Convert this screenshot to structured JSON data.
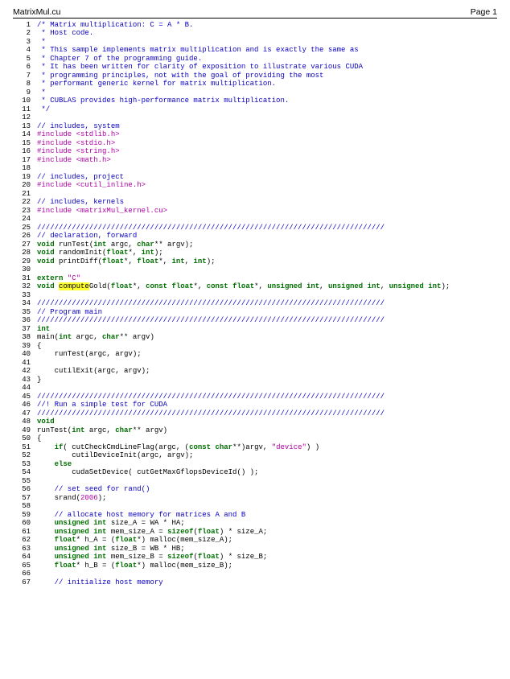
{
  "header": {
    "filename": "MatrixMul.cu",
    "page_label": "Page 1"
  },
  "code_lines": [
    {
      "n": 1,
      "tokens": [
        {
          "t": "/* Matrix multiplication: C = A * B.",
          "c": "c-comment"
        }
      ]
    },
    {
      "n": 2,
      "tokens": [
        {
          "t": " * Host code.",
          "c": "c-comment"
        }
      ]
    },
    {
      "n": 3,
      "tokens": [
        {
          "t": " *",
          "c": "c-comment"
        }
      ]
    },
    {
      "n": 4,
      "tokens": [
        {
          "t": " * This sample implements matrix multiplication and is exactly the same as",
          "c": "c-comment"
        }
      ]
    },
    {
      "n": 5,
      "tokens": [
        {
          "t": " * Chapter 7 of the programming guide.",
          "c": "c-comment"
        }
      ]
    },
    {
      "n": 6,
      "tokens": [
        {
          "t": " * It has been written for clarity of exposition to illustrate various CUDA",
          "c": "c-comment"
        }
      ]
    },
    {
      "n": 7,
      "tokens": [
        {
          "t": " * programming principles, not with the goal of providing the most",
          "c": "c-comment"
        }
      ]
    },
    {
      "n": 8,
      "tokens": [
        {
          "t": " * performant generic kernel for matrix multiplication.",
          "c": "c-comment"
        }
      ]
    },
    {
      "n": 9,
      "tokens": [
        {
          "t": " *",
          "c": "c-comment"
        }
      ]
    },
    {
      "n": 10,
      "tokens": [
        {
          "t": " * CUBLAS provides high-performance matrix multiplication.",
          "c": "c-comment"
        }
      ]
    },
    {
      "n": 11,
      "tokens": [
        {
          "t": " */",
          "c": "c-comment"
        }
      ]
    },
    {
      "n": 12,
      "tokens": []
    },
    {
      "n": 13,
      "tokens": [
        {
          "t": "// includes, system",
          "c": "c-comment"
        }
      ]
    },
    {
      "n": 14,
      "tokens": [
        {
          "t": "#include ",
          "c": "c-pp"
        },
        {
          "t": "<stdlib.h>",
          "c": "c-str"
        }
      ]
    },
    {
      "n": 15,
      "tokens": [
        {
          "t": "#include ",
          "c": "c-pp"
        },
        {
          "t": "<stdio.h>",
          "c": "c-str"
        }
      ]
    },
    {
      "n": 16,
      "tokens": [
        {
          "t": "#include ",
          "c": "c-pp"
        },
        {
          "t": "<string.h>",
          "c": "c-str"
        }
      ]
    },
    {
      "n": 17,
      "tokens": [
        {
          "t": "#include ",
          "c": "c-pp"
        },
        {
          "t": "<math.h>",
          "c": "c-str"
        }
      ]
    },
    {
      "n": 18,
      "tokens": []
    },
    {
      "n": 19,
      "tokens": [
        {
          "t": "// includes, project",
          "c": "c-comment"
        }
      ]
    },
    {
      "n": 20,
      "tokens": [
        {
          "t": "#include ",
          "c": "c-pp"
        },
        {
          "t": "<cutil_inline.h>",
          "c": "c-str"
        }
      ]
    },
    {
      "n": 21,
      "tokens": []
    },
    {
      "n": 22,
      "tokens": [
        {
          "t": "// includes, kernels",
          "c": "c-comment"
        }
      ]
    },
    {
      "n": 23,
      "tokens": [
        {
          "t": "#include ",
          "c": "c-pp"
        },
        {
          "t": "<matrixMul_kernel.cu>",
          "c": "c-str"
        }
      ]
    },
    {
      "n": 24,
      "tokens": []
    },
    {
      "n": 25,
      "tokens": [
        {
          "t": "////////////////////////////////////////////////////////////////////////////////",
          "c": "c-comment"
        }
      ]
    },
    {
      "n": 26,
      "tokens": [
        {
          "t": "// declaration, forward",
          "c": "c-comment"
        }
      ]
    },
    {
      "n": 27,
      "tokens": [
        {
          "t": "void",
          "c": "c-kw"
        },
        {
          "t": " runTest("
        },
        {
          "t": "int",
          "c": "c-kw"
        },
        {
          "t": " argc, "
        },
        {
          "t": "char",
          "c": "c-kw"
        },
        {
          "t": "** argv);"
        }
      ]
    },
    {
      "n": 28,
      "tokens": [
        {
          "t": "void",
          "c": "c-kw"
        },
        {
          "t": " randomInit("
        },
        {
          "t": "float",
          "c": "c-kw"
        },
        {
          "t": "*, "
        },
        {
          "t": "int",
          "c": "c-kw"
        },
        {
          "t": ");"
        }
      ]
    },
    {
      "n": 29,
      "tokens": [
        {
          "t": "void",
          "c": "c-kw"
        },
        {
          "t": " printDiff("
        },
        {
          "t": "float",
          "c": "c-kw"
        },
        {
          "t": "*, "
        },
        {
          "t": "float",
          "c": "c-kw"
        },
        {
          "t": "*, "
        },
        {
          "t": "int",
          "c": "c-kw"
        },
        {
          "t": ", "
        },
        {
          "t": "int",
          "c": "c-kw"
        },
        {
          "t": ");"
        }
      ]
    },
    {
      "n": 30,
      "tokens": []
    },
    {
      "n": 31,
      "tokens": [
        {
          "t": "extern",
          "c": "c-kw"
        },
        {
          "t": " "
        },
        {
          "t": "\"C\"",
          "c": "c-str"
        }
      ]
    },
    {
      "n": 32,
      "tokens": [
        {
          "t": "void",
          "c": "c-kw"
        },
        {
          "t": " "
        },
        {
          "t": "compute",
          "c": "c-hl"
        },
        {
          "t": "Gold("
        },
        {
          "t": "float",
          "c": "c-kw"
        },
        {
          "t": "*, "
        },
        {
          "t": "const",
          "c": "c-kw"
        },
        {
          "t": " "
        },
        {
          "t": "float",
          "c": "c-kw"
        },
        {
          "t": "*, "
        },
        {
          "t": "const",
          "c": "c-kw"
        },
        {
          "t": " "
        },
        {
          "t": "float",
          "c": "c-kw"
        },
        {
          "t": "*, "
        },
        {
          "t": "unsigned",
          "c": "c-kw"
        },
        {
          "t": " "
        },
        {
          "t": "int",
          "c": "c-kw"
        },
        {
          "t": ", "
        },
        {
          "t": "unsigned",
          "c": "c-kw"
        },
        {
          "t": " "
        },
        {
          "t": "int",
          "c": "c-kw"
        },
        {
          "t": ", "
        },
        {
          "t": "unsigned",
          "c": "c-kw"
        },
        {
          "t": " "
        },
        {
          "t": "int",
          "c": "c-kw"
        },
        {
          "t": ");"
        }
      ]
    },
    {
      "n": 33,
      "tokens": []
    },
    {
      "n": 34,
      "tokens": [
        {
          "t": "////////////////////////////////////////////////////////////////////////////////",
          "c": "c-comment"
        }
      ]
    },
    {
      "n": 35,
      "tokens": [
        {
          "t": "// Program main",
          "c": "c-comment"
        }
      ]
    },
    {
      "n": 36,
      "tokens": [
        {
          "t": "////////////////////////////////////////////////////////////////////////////////",
          "c": "c-comment"
        }
      ]
    },
    {
      "n": 37,
      "tokens": [
        {
          "t": "int",
          "c": "c-kw"
        }
      ]
    },
    {
      "n": 38,
      "tokens": [
        {
          "t": "main("
        },
        {
          "t": "int",
          "c": "c-kw"
        },
        {
          "t": " argc, "
        },
        {
          "t": "char",
          "c": "c-kw"
        },
        {
          "t": "** argv)"
        }
      ]
    },
    {
      "n": 39,
      "tokens": [
        {
          "t": "{"
        }
      ]
    },
    {
      "n": 40,
      "tokens": [
        {
          "t": "    runTest(argc, argv);"
        }
      ]
    },
    {
      "n": 41,
      "tokens": []
    },
    {
      "n": 42,
      "tokens": [
        {
          "t": "    cutilExit(argc, argv);"
        }
      ]
    },
    {
      "n": 43,
      "tokens": [
        {
          "t": "}"
        }
      ]
    },
    {
      "n": 44,
      "tokens": []
    },
    {
      "n": 45,
      "tokens": [
        {
          "t": "////////////////////////////////////////////////////////////////////////////////",
          "c": "c-comment"
        }
      ]
    },
    {
      "n": 46,
      "tokens": [
        {
          "t": "//! Run a simple test for CUDA",
          "c": "c-comment"
        }
      ]
    },
    {
      "n": 47,
      "tokens": [
        {
          "t": "////////////////////////////////////////////////////////////////////////////////",
          "c": "c-comment"
        }
      ]
    },
    {
      "n": 48,
      "tokens": [
        {
          "t": "void",
          "c": "c-kw"
        }
      ]
    },
    {
      "n": 49,
      "tokens": [
        {
          "t": "runTest("
        },
        {
          "t": "int",
          "c": "c-kw"
        },
        {
          "t": " argc, "
        },
        {
          "t": "char",
          "c": "c-kw"
        },
        {
          "t": "** argv)"
        }
      ]
    },
    {
      "n": 50,
      "tokens": [
        {
          "t": "{"
        }
      ]
    },
    {
      "n": 51,
      "tokens": [
        {
          "t": "    "
        },
        {
          "t": "if",
          "c": "c-kw"
        },
        {
          "t": "( cutCheckCmdLineFlag(argc, ("
        },
        {
          "t": "const",
          "c": "c-kw"
        },
        {
          "t": " "
        },
        {
          "t": "char",
          "c": "c-kw"
        },
        {
          "t": "**)argv, "
        },
        {
          "t": "\"device\"",
          "c": "c-str"
        },
        {
          "t": ") )"
        }
      ]
    },
    {
      "n": 52,
      "tokens": [
        {
          "t": "        cutilDeviceInit(argc, argv);"
        }
      ]
    },
    {
      "n": 53,
      "tokens": [
        {
          "t": "    "
        },
        {
          "t": "else",
          "c": "c-kw"
        }
      ]
    },
    {
      "n": 54,
      "tokens": [
        {
          "t": "        cudaSetDevice( cutGetMaxGflopsDeviceId() );"
        }
      ]
    },
    {
      "n": 55,
      "tokens": []
    },
    {
      "n": 56,
      "tokens": [
        {
          "t": "    "
        },
        {
          "t": "// set seed for rand()",
          "c": "c-comment"
        }
      ]
    },
    {
      "n": 57,
      "tokens": [
        {
          "t": "    srand("
        },
        {
          "t": "2006",
          "c": "c-num"
        },
        {
          "t": ");"
        }
      ]
    },
    {
      "n": 58,
      "tokens": []
    },
    {
      "n": 59,
      "tokens": [
        {
          "t": "    "
        },
        {
          "t": "// allocate host memory for matrices A and B",
          "c": "c-comment"
        }
      ]
    },
    {
      "n": 60,
      "tokens": [
        {
          "t": "    "
        },
        {
          "t": "unsigned",
          "c": "c-kw"
        },
        {
          "t": " "
        },
        {
          "t": "int",
          "c": "c-kw"
        },
        {
          "t": " size_A = WA * HA;"
        }
      ]
    },
    {
      "n": 61,
      "tokens": [
        {
          "t": "    "
        },
        {
          "t": "unsigned",
          "c": "c-kw"
        },
        {
          "t": " "
        },
        {
          "t": "int",
          "c": "c-kw"
        },
        {
          "t": " mem_size_A = "
        },
        {
          "t": "sizeof",
          "c": "c-kw"
        },
        {
          "t": "("
        },
        {
          "t": "float",
          "c": "c-kw"
        },
        {
          "t": ") * size_A;"
        }
      ]
    },
    {
      "n": 62,
      "tokens": [
        {
          "t": "    "
        },
        {
          "t": "float",
          "c": "c-kw"
        },
        {
          "t": "* h_A = ("
        },
        {
          "t": "float",
          "c": "c-kw"
        },
        {
          "t": "*) malloc(mem_size_A);"
        }
      ]
    },
    {
      "n": 63,
      "tokens": [
        {
          "t": "    "
        },
        {
          "t": "unsigned",
          "c": "c-kw"
        },
        {
          "t": " "
        },
        {
          "t": "int",
          "c": "c-kw"
        },
        {
          "t": " size_B = WB * HB;"
        }
      ]
    },
    {
      "n": 64,
      "tokens": [
        {
          "t": "    "
        },
        {
          "t": "unsigned",
          "c": "c-kw"
        },
        {
          "t": " "
        },
        {
          "t": "int",
          "c": "c-kw"
        },
        {
          "t": " mem_size_B = "
        },
        {
          "t": "sizeof",
          "c": "c-kw"
        },
        {
          "t": "("
        },
        {
          "t": "float",
          "c": "c-kw"
        },
        {
          "t": ") * size_B;"
        }
      ]
    },
    {
      "n": 65,
      "tokens": [
        {
          "t": "    "
        },
        {
          "t": "float",
          "c": "c-kw"
        },
        {
          "t": "* h_B = ("
        },
        {
          "t": "float",
          "c": "c-kw"
        },
        {
          "t": "*) malloc(mem_size_B);"
        }
      ]
    },
    {
      "n": 66,
      "tokens": []
    },
    {
      "n": 67,
      "tokens": [
        {
          "t": "    "
        },
        {
          "t": "// initialize host memory",
          "c": "c-comment"
        }
      ]
    }
  ]
}
